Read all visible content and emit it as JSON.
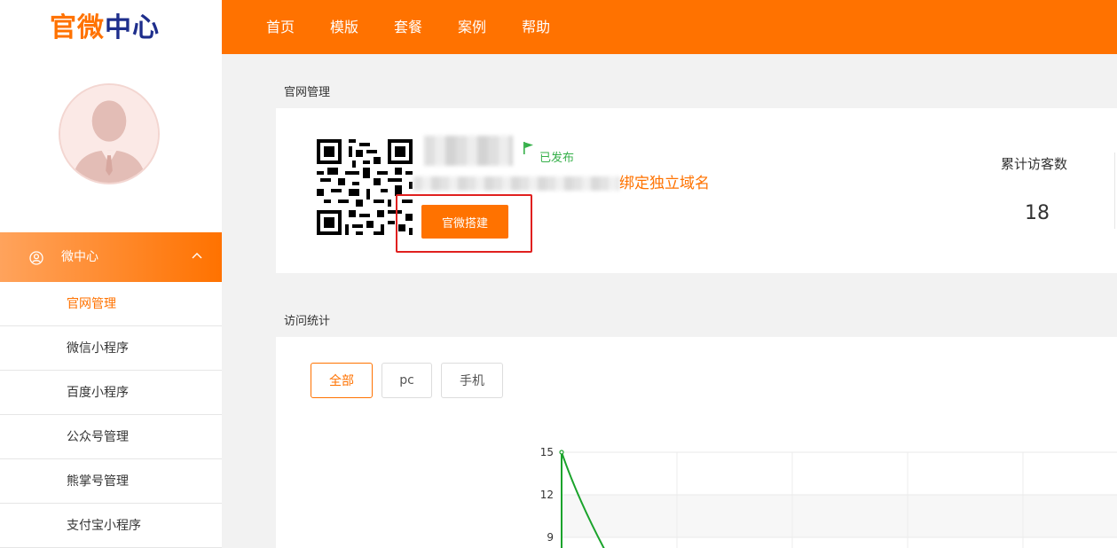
{
  "brand": {
    "part1": "官微",
    "part2": "中心"
  },
  "topnav": {
    "items": [
      "首页",
      "模版",
      "套餐",
      "案例",
      "帮助"
    ]
  },
  "sidebar": {
    "menu_label": "微中心",
    "items": [
      {
        "label": "官网管理",
        "active": true
      },
      {
        "label": "微信小程序",
        "active": false
      },
      {
        "label": "百度小程序",
        "active": false
      },
      {
        "label": "公众号管理",
        "active": false
      },
      {
        "label": "熊掌号管理",
        "active": false
      },
      {
        "label": "支付宝小程序",
        "active": false
      }
    ]
  },
  "site": {
    "section_title": "官网管理",
    "status": "已发布",
    "bind_domain_label": "绑定独立域名",
    "build_button": "官微搭建",
    "visitors_label": "累计访客数",
    "visitors_value": "18"
  },
  "stats": {
    "section_title": "访问统计",
    "filters": [
      "全部",
      "pc",
      "手机"
    ],
    "active_filter": "全部"
  },
  "colors": {
    "accent": "#ff7200",
    "brand_blue": "#1e2e8c",
    "status_green": "#36b04a",
    "highlight_red": "#e0201f",
    "line": "#1aa32b"
  },
  "icons": [
    "user-circle-icon",
    "chevron-up-icon",
    "flag-icon",
    "qr-code-icon",
    "avatar-placeholder-icon"
  ],
  "chart_data": {
    "type": "line",
    "y_ticks": [
      "15",
      "12",
      "9"
    ],
    "ylim": [
      9,
      15
    ],
    "series": [
      {
        "points": [
          [
            0,
            15
          ],
          [
            0.44,
            9
          ]
        ]
      }
    ],
    "grid": true
  }
}
